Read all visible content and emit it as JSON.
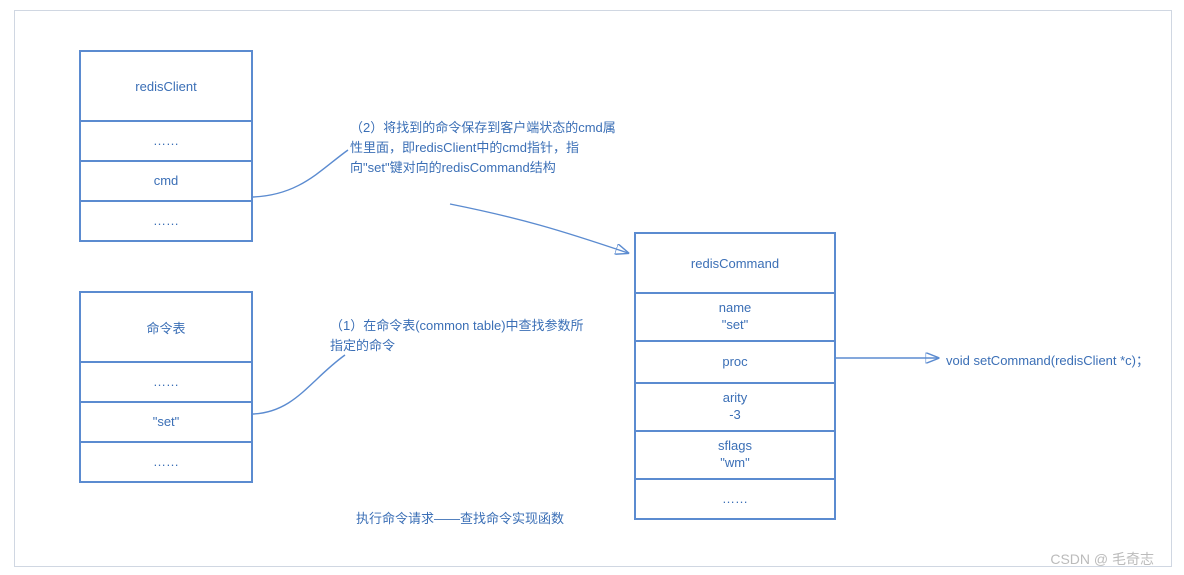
{
  "redisClient": {
    "title": "redisClient",
    "rows": [
      "……",
      "cmd",
      "……"
    ]
  },
  "commandTable": {
    "title": "命令表",
    "rows": [
      "……",
      "\"set\"",
      "……"
    ]
  },
  "redisCommand": {
    "title": "redisCommand",
    "rows": [
      {
        "line1": "name",
        "line2": "\"set\""
      },
      {
        "line1": "proc",
        "line2": ""
      },
      {
        "line1": "arity",
        "line2": "-3"
      },
      {
        "line1": "sflags",
        "line2": "\"wm\""
      },
      {
        "line1": "……",
        "line2": ""
      }
    ]
  },
  "annotations": {
    "step2": "（2）将找到的命令保存到客户端状态的cmd属性里面，即redisClient中的cmd指针，指向\"set\"键对向的redisCommand结构",
    "step1": "（1）在命令表(common table)中查找参数所指定的命令"
  },
  "procSignature": "void  setCommand(redisClient *c)；",
  "caption": "执行命令请求——查找命令实现函数",
  "watermark": "CSDN @ 毛奇志"
}
